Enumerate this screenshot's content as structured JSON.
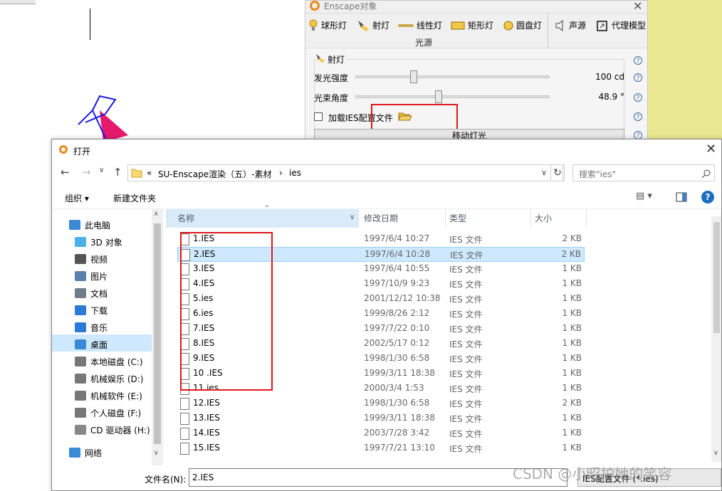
{
  "enscape": {
    "title": "Enscape对象",
    "toolbar": [
      {
        "label": "球形灯",
        "icon": "bulb-icon"
      },
      {
        "label": "射灯",
        "icon": "spotlight-icon"
      },
      {
        "label": "线性灯",
        "icon": "linear-light-icon"
      },
      {
        "label": "矩形灯",
        "icon": "rect-light-icon"
      },
      {
        "label": "圆盘灯",
        "icon": "disk-light-icon"
      },
      {
        "label": "声源",
        "icon": "speaker-icon"
      },
      {
        "label": "代理模型",
        "icon": "proxy-model-icon"
      }
    ],
    "group_label": "光源",
    "section_title": "射灯",
    "intensity": {
      "label": "发光强度",
      "value": "100 cd",
      "level": 0.3
    },
    "beam_angle": {
      "label": "光束角度",
      "value": "48.9 °",
      "level": 0.43
    },
    "ies_label": "加载IES配置文件",
    "move_button": "移动灯光",
    "accent": "#e8891c"
  },
  "dialog": {
    "title": "打开",
    "breadcrumb": [
      "«",
      "SU-Enscape渲染（五）-素材",
      "›",
      "ies"
    ],
    "search_placeholder": "搜索\"ies\"",
    "organize": "组织 ▾",
    "new_folder": "新建文件夹",
    "nav": [
      {
        "label": "此电脑",
        "icon": "pc-icon"
      },
      {
        "label": "3D 对象",
        "icon": "3d-objects-icon"
      },
      {
        "label": "视频",
        "icon": "video-icon"
      },
      {
        "label": "图片",
        "icon": "pictures-icon"
      },
      {
        "label": "文档",
        "icon": "documents-icon"
      },
      {
        "label": "下载",
        "icon": "download-icon"
      },
      {
        "label": "音乐",
        "icon": "music-icon"
      },
      {
        "label": "桌面",
        "icon": "desktop-icon"
      },
      {
        "label": "本地磁盘 (C:)",
        "icon": "drive-icon"
      },
      {
        "label": "机械娱乐 (D:)",
        "icon": "drive-icon"
      },
      {
        "label": "机械软件 (E:)",
        "icon": "drive-icon"
      },
      {
        "label": "个人磁盘 (F:)",
        "icon": "drive-icon"
      },
      {
        "label": "CD 驱动器 (H:)",
        "icon": "cd-drive-icon"
      },
      {
        "label": "网络",
        "icon": "network-icon"
      }
    ],
    "columns": [
      "名称",
      "修改日期",
      "类型",
      "大小"
    ],
    "files": [
      {
        "name": "1.IES",
        "date": "1997/6/4 10:27",
        "type": "IES 文件",
        "size": "2 KB"
      },
      {
        "name": "2.IES",
        "date": "1997/6/4 10:28",
        "type": "IES 文件",
        "size": "2 KB"
      },
      {
        "name": "3.IES",
        "date": "1997/6/4 10:55",
        "type": "IES 文件",
        "size": "1 KB"
      },
      {
        "name": "4.IES",
        "date": "1997/10/9 9:23",
        "type": "IES 文件",
        "size": "1 KB"
      },
      {
        "name": "5.ies",
        "date": "2001/12/12 10:38",
        "type": "IES 文件",
        "size": "1 KB"
      },
      {
        "name": "6.ies",
        "date": "1999/8/26 2:12",
        "type": "IES 文件",
        "size": "1 KB"
      },
      {
        "name": "7.IES",
        "date": "1997/7/22 0:10",
        "type": "IES 文件",
        "size": "1 KB"
      },
      {
        "name": "8.IES",
        "date": "2002/5/17 0:12",
        "type": "IES 文件",
        "size": "1 KB"
      },
      {
        "name": "9.IES",
        "date": "1998/1/30 6:58",
        "type": "IES 文件",
        "size": "1 KB"
      },
      {
        "name": "10 .IES",
        "date": "1999/3/11 18:38",
        "type": "IES 文件",
        "size": "1 KB"
      },
      {
        "name": "11.ies",
        "date": "2000/3/4 1:53",
        "type": "IES 文件",
        "size": "1 KB"
      },
      {
        "name": "12.IES",
        "date": "1998/1/30 6:58",
        "type": "IES 文件",
        "size": "2 KB"
      },
      {
        "name": "13.IES",
        "date": "1999/3/11 18:38",
        "type": "IES 文件",
        "size": "1 KB"
      },
      {
        "name": "14.IES",
        "date": "2003/7/28 3:42",
        "type": "IES 文件",
        "size": "1 KB"
      },
      {
        "name": "15.IES",
        "date": "1997/7/21 13:10",
        "type": "IES 文件",
        "size": "1 KB"
      }
    ],
    "selected_file": "2.IES",
    "filename_label": "文件名(N):",
    "filename_value": "2.IES",
    "filter_value": "IES配置文件 (*.ies)"
  },
  "watermark": "CSDN @小昭护她的笑容",
  "colors": {
    "selection": "#cde8ff",
    "annotation": "#e0161d",
    "background_right": "#e9e890"
  }
}
